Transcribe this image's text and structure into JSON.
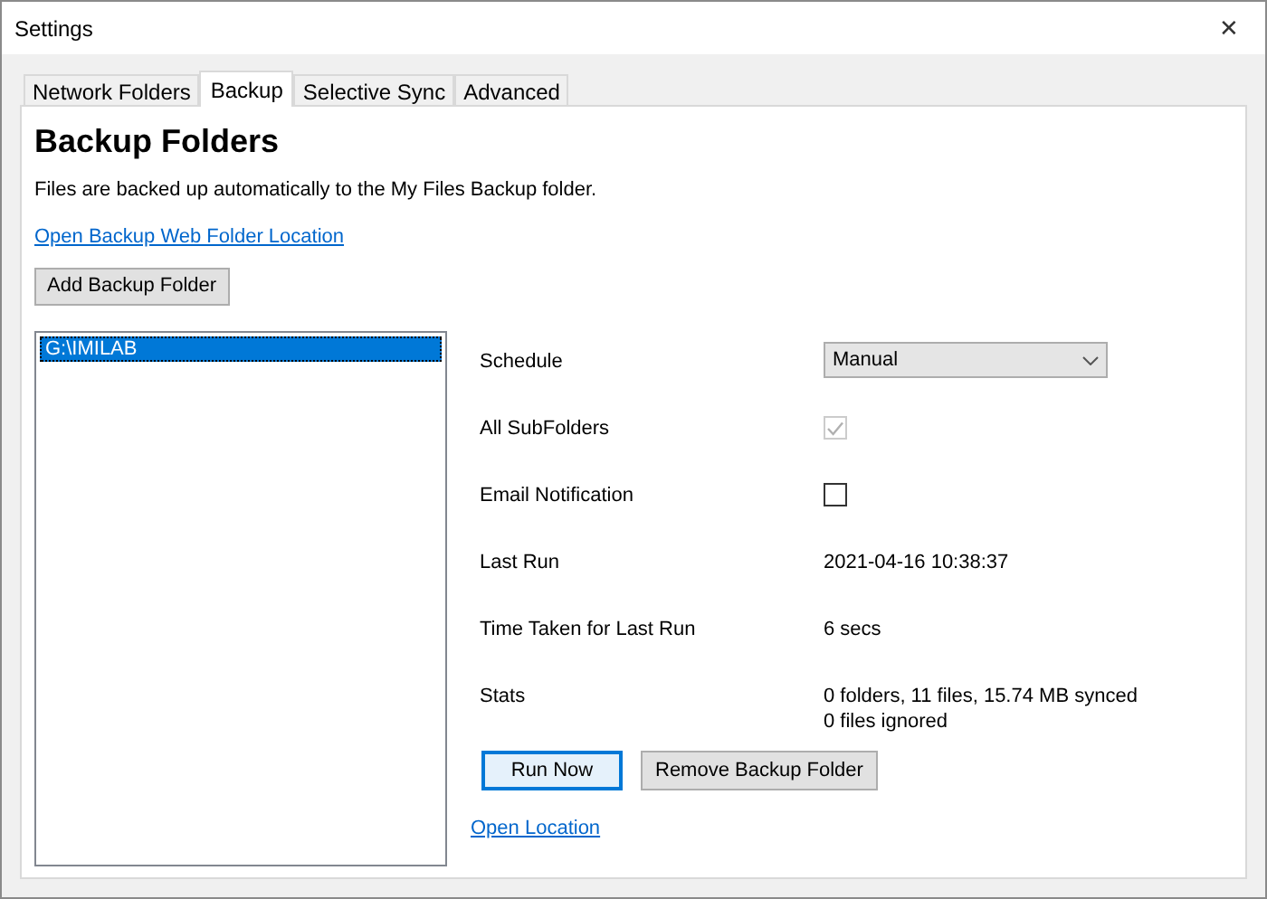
{
  "window": {
    "title": "Settings",
    "close": "✕"
  },
  "tabs": [
    {
      "label": "Network Folders",
      "selected": false
    },
    {
      "label": "Backup",
      "selected": true
    },
    {
      "label": "Selective Sync",
      "selected": false
    },
    {
      "label": "Advanced",
      "selected": false
    }
  ],
  "heading": "Backup Folders",
  "description": "Files are backed up automatically to the My Files Backup folder.",
  "web_link": "Open Backup Web Folder Location",
  "add_button": "Add Backup Folder",
  "folders": [
    {
      "path": "G:\\IMILAB",
      "selected": true
    }
  ],
  "properties": [
    {
      "kind": "dropdown",
      "label": "Schedule",
      "value": "Manual"
    },
    {
      "kind": "checkbox",
      "label": "All SubFolders",
      "checked": true,
      "disabled": true
    },
    {
      "kind": "checkbox",
      "label": "Email Notification",
      "checked": false,
      "disabled": false
    },
    {
      "kind": "text",
      "label": "Last Run",
      "lines": [
        "2021-04-16 10:38:37"
      ]
    },
    {
      "kind": "text",
      "label": "Time Taken for Last Run",
      "lines": [
        "6 secs"
      ]
    },
    {
      "kind": "text",
      "label": "Stats",
      "lines": [
        "0 folders, 11 files, 15.74 MB synced",
        "0 files ignored"
      ]
    }
  ],
  "buttons": [
    {
      "label": "Run Now",
      "default": true
    },
    {
      "label": "Remove Backup Folder",
      "default": false
    }
  ],
  "open_location": "Open Location"
}
